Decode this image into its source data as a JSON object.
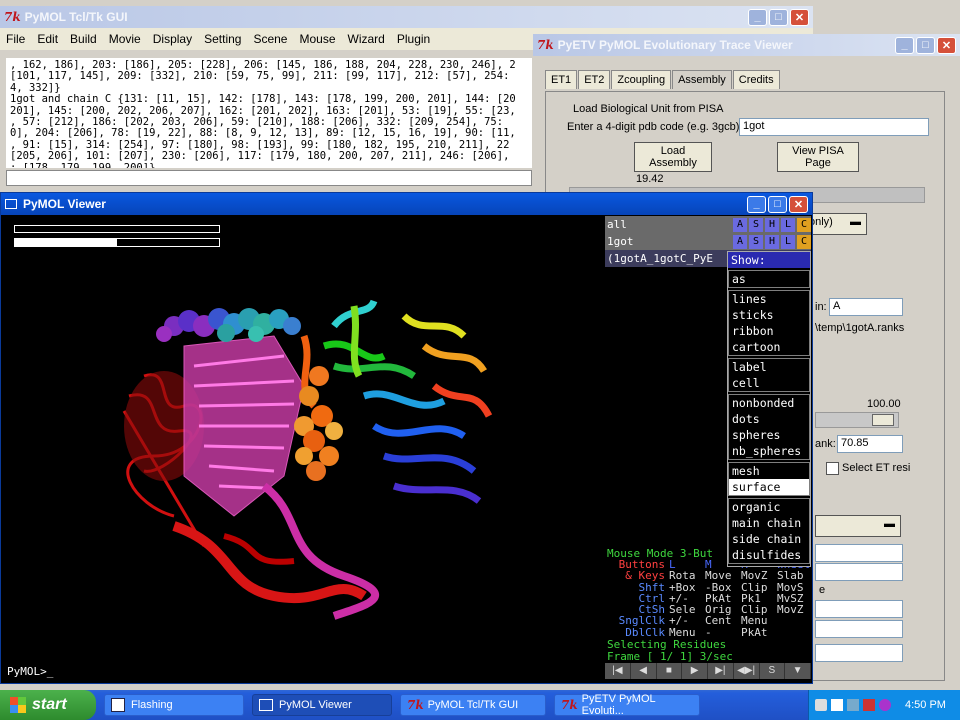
{
  "colors": {
    "accent": "#0a246a",
    "viewer_bg": "#000000",
    "panel_bg": "#000000"
  },
  "tk_window": {
    "title": "PyMOL Tcl/Tk GUI",
    "menu": [
      "File",
      "Edit",
      "Build",
      "Movie",
      "Display",
      "Setting",
      "Scene",
      "Mouse",
      "Wizard",
      "Plugin"
    ],
    "output": ", 162, 186], 203: [186], 205: [228], 206: [145, 186, 188, 204, 228, 230, 246], 2\n[101, 117, 145], 209: [332], 210: [59, 75, 99], 211: [99, 117], 212: [57], 254:\n4, 332]}\n1got and chain C {131: [11, 15], 142: [178], 143: [178, 199, 200, 201], 144: [20\n201], 145: [200, 202, 206, 207], 162: [201, 202], 163: [201], 53: [19], 55: [23,\n, 57: [212], 186: [202, 203, 206], 59: [210], 188: [206], 332: [209, 254], 75:\n0], 204: [206], 78: [19, 22], 88: [8, 9, 12, 13], 89: [12, 15, 16, 19], 90: [11,\n, 91: [15], 314: [254], 97: [180], 98: [193], 99: [180, 182, 195, 210, 211], 22\n[205, 206], 101: [207], 230: [206], 117: [179, 180, 200, 207, 211], 246: [206],\n: [178, 179, 199, 200]}"
  },
  "et_window": {
    "title": "PyETV PyMOL Evolutionary Trace Viewer",
    "tabs": [
      "ET1",
      "ET2",
      "Zcoupling",
      "Assembly",
      "Credits"
    ],
    "selected_tab": "Assembly",
    "group_label": "Load Biological Unit from PISA",
    "pdb_label": "Enter a 4-digit pdb code (e.g. 3gcb):",
    "pdb_value": "1got",
    "load_button": "Load Assembly",
    "view_button": "View PISA Page",
    "value": "19.42",
    "dropdown_value": "only)",
    "chain_label": "in:",
    "chain_value": "A",
    "ranks_path": "\\temp\\1gotA.ranks",
    "slider_max": "100.00",
    "rank_label": "ank:",
    "rank_value": "70.85",
    "select_label": "Select ET resi",
    "partial_label": "e"
  },
  "viewer": {
    "title": "PyMOL Viewer",
    "prompt": "PyMOL>_",
    "progress_fraction": 0.5
  },
  "panel": {
    "objects": [
      {
        "name": "all",
        "buttons": [
          "A",
          "S",
          "H",
          "L",
          "C"
        ]
      },
      {
        "name": "1got",
        "buttons": [
          "A",
          "S",
          "H",
          "L",
          "C"
        ]
      },
      {
        "name": "(1gotA_1gotC_PyE",
        "buttons": []
      }
    ],
    "show_menu": {
      "title": "Show:",
      "groups": [
        [
          "as"
        ],
        [
          "lines",
          "sticks",
          "ribbon",
          "cartoon"
        ],
        [
          "label",
          "cell"
        ],
        [
          "nonbonded",
          "dots",
          "spheres",
          "nb_spheres"
        ],
        [
          "mesh",
          "surface"
        ],
        [
          "organic",
          "main chain",
          "side chain",
          "disulfides"
        ]
      ],
      "highlighted": "surface"
    },
    "mouse_mode": "Mouse Mode 3-But",
    "mouse_table": [
      {
        "label": "Buttons",
        "cols": [
          "L",
          "M",
          "R",
          "Wheel"
        ]
      },
      {
        "label": "& Keys",
        "cols": [
          "Rota",
          "Move",
          "MovZ",
          "Slab"
        ]
      },
      {
        "label": "Shft",
        "cols": [
          "+Box",
          "-Box",
          "Clip",
          "MovS"
        ]
      },
      {
        "label": "Ctrl",
        "cols": [
          "+/-",
          "PkAt",
          "Pk1",
          "MvSZ"
        ]
      },
      {
        "label": "CtSh",
        "cols": [
          "Sele",
          "Orig",
          "Clip",
          "MovZ"
        ]
      },
      {
        "label": "SnglClk",
        "cols": [
          "+/-",
          "Cent",
          "Menu",
          ""
        ]
      },
      {
        "label": "DblClk",
        "cols": [
          "Menu",
          "-",
          "PkAt",
          ""
        ]
      }
    ],
    "selecting": "Selecting Residues",
    "frame": "Frame [  1/   1] 3/sec",
    "transport": [
      "|◀",
      "◀",
      "■",
      "▶",
      "▶|",
      "◀▶|",
      "S",
      "▼"
    ]
  },
  "taskbar": {
    "start": "start",
    "tasks": [
      "Flashing",
      "PyMOL Viewer",
      "PyMOL Tcl/Tk GUI",
      "PyETV PyMOL Evoluti..."
    ],
    "active": "PyMOL Viewer",
    "clock": "4:50 PM"
  }
}
